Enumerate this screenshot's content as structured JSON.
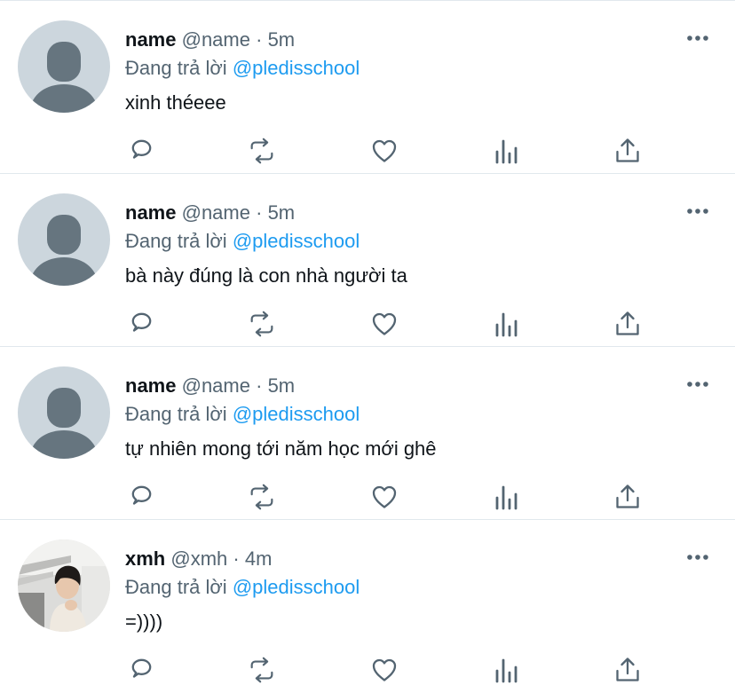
{
  "reply_prefix": "Đang trả lời",
  "separator": "·",
  "colors": {
    "text": "#0f1419",
    "muted": "#536471",
    "link": "#1d9bf0",
    "divider": "#e1e8ed",
    "default_avatar_bg": "#ccd6dd",
    "default_avatar_fg": "#66757f"
  },
  "icons": {
    "more": "more-icon",
    "reply": "reply-icon",
    "retweet": "retweet-icon",
    "like": "like-icon",
    "analytics": "analytics-icon",
    "share": "share-icon"
  },
  "tweets": [
    {
      "name": "name",
      "handle": "@name",
      "time": "5m",
      "reply_to": "@pledisschool",
      "text": "xinh théeee",
      "avatar": "default"
    },
    {
      "name": "name",
      "handle": "@name",
      "time": "5m",
      "reply_to": "@pledisschool",
      "text": "bà này đúng là con nhà người ta",
      "avatar": "default"
    },
    {
      "name": "name",
      "handle": "@name",
      "time": "5m",
      "reply_to": "@pledisschool",
      "text": "tự nhiên mong tới năm học mới ghê",
      "avatar": "default"
    },
    {
      "name": "xmh",
      "handle": "@xmh",
      "time": "4m",
      "reply_to": "@pledisschool",
      "text": "=))))",
      "avatar": "photo"
    }
  ]
}
